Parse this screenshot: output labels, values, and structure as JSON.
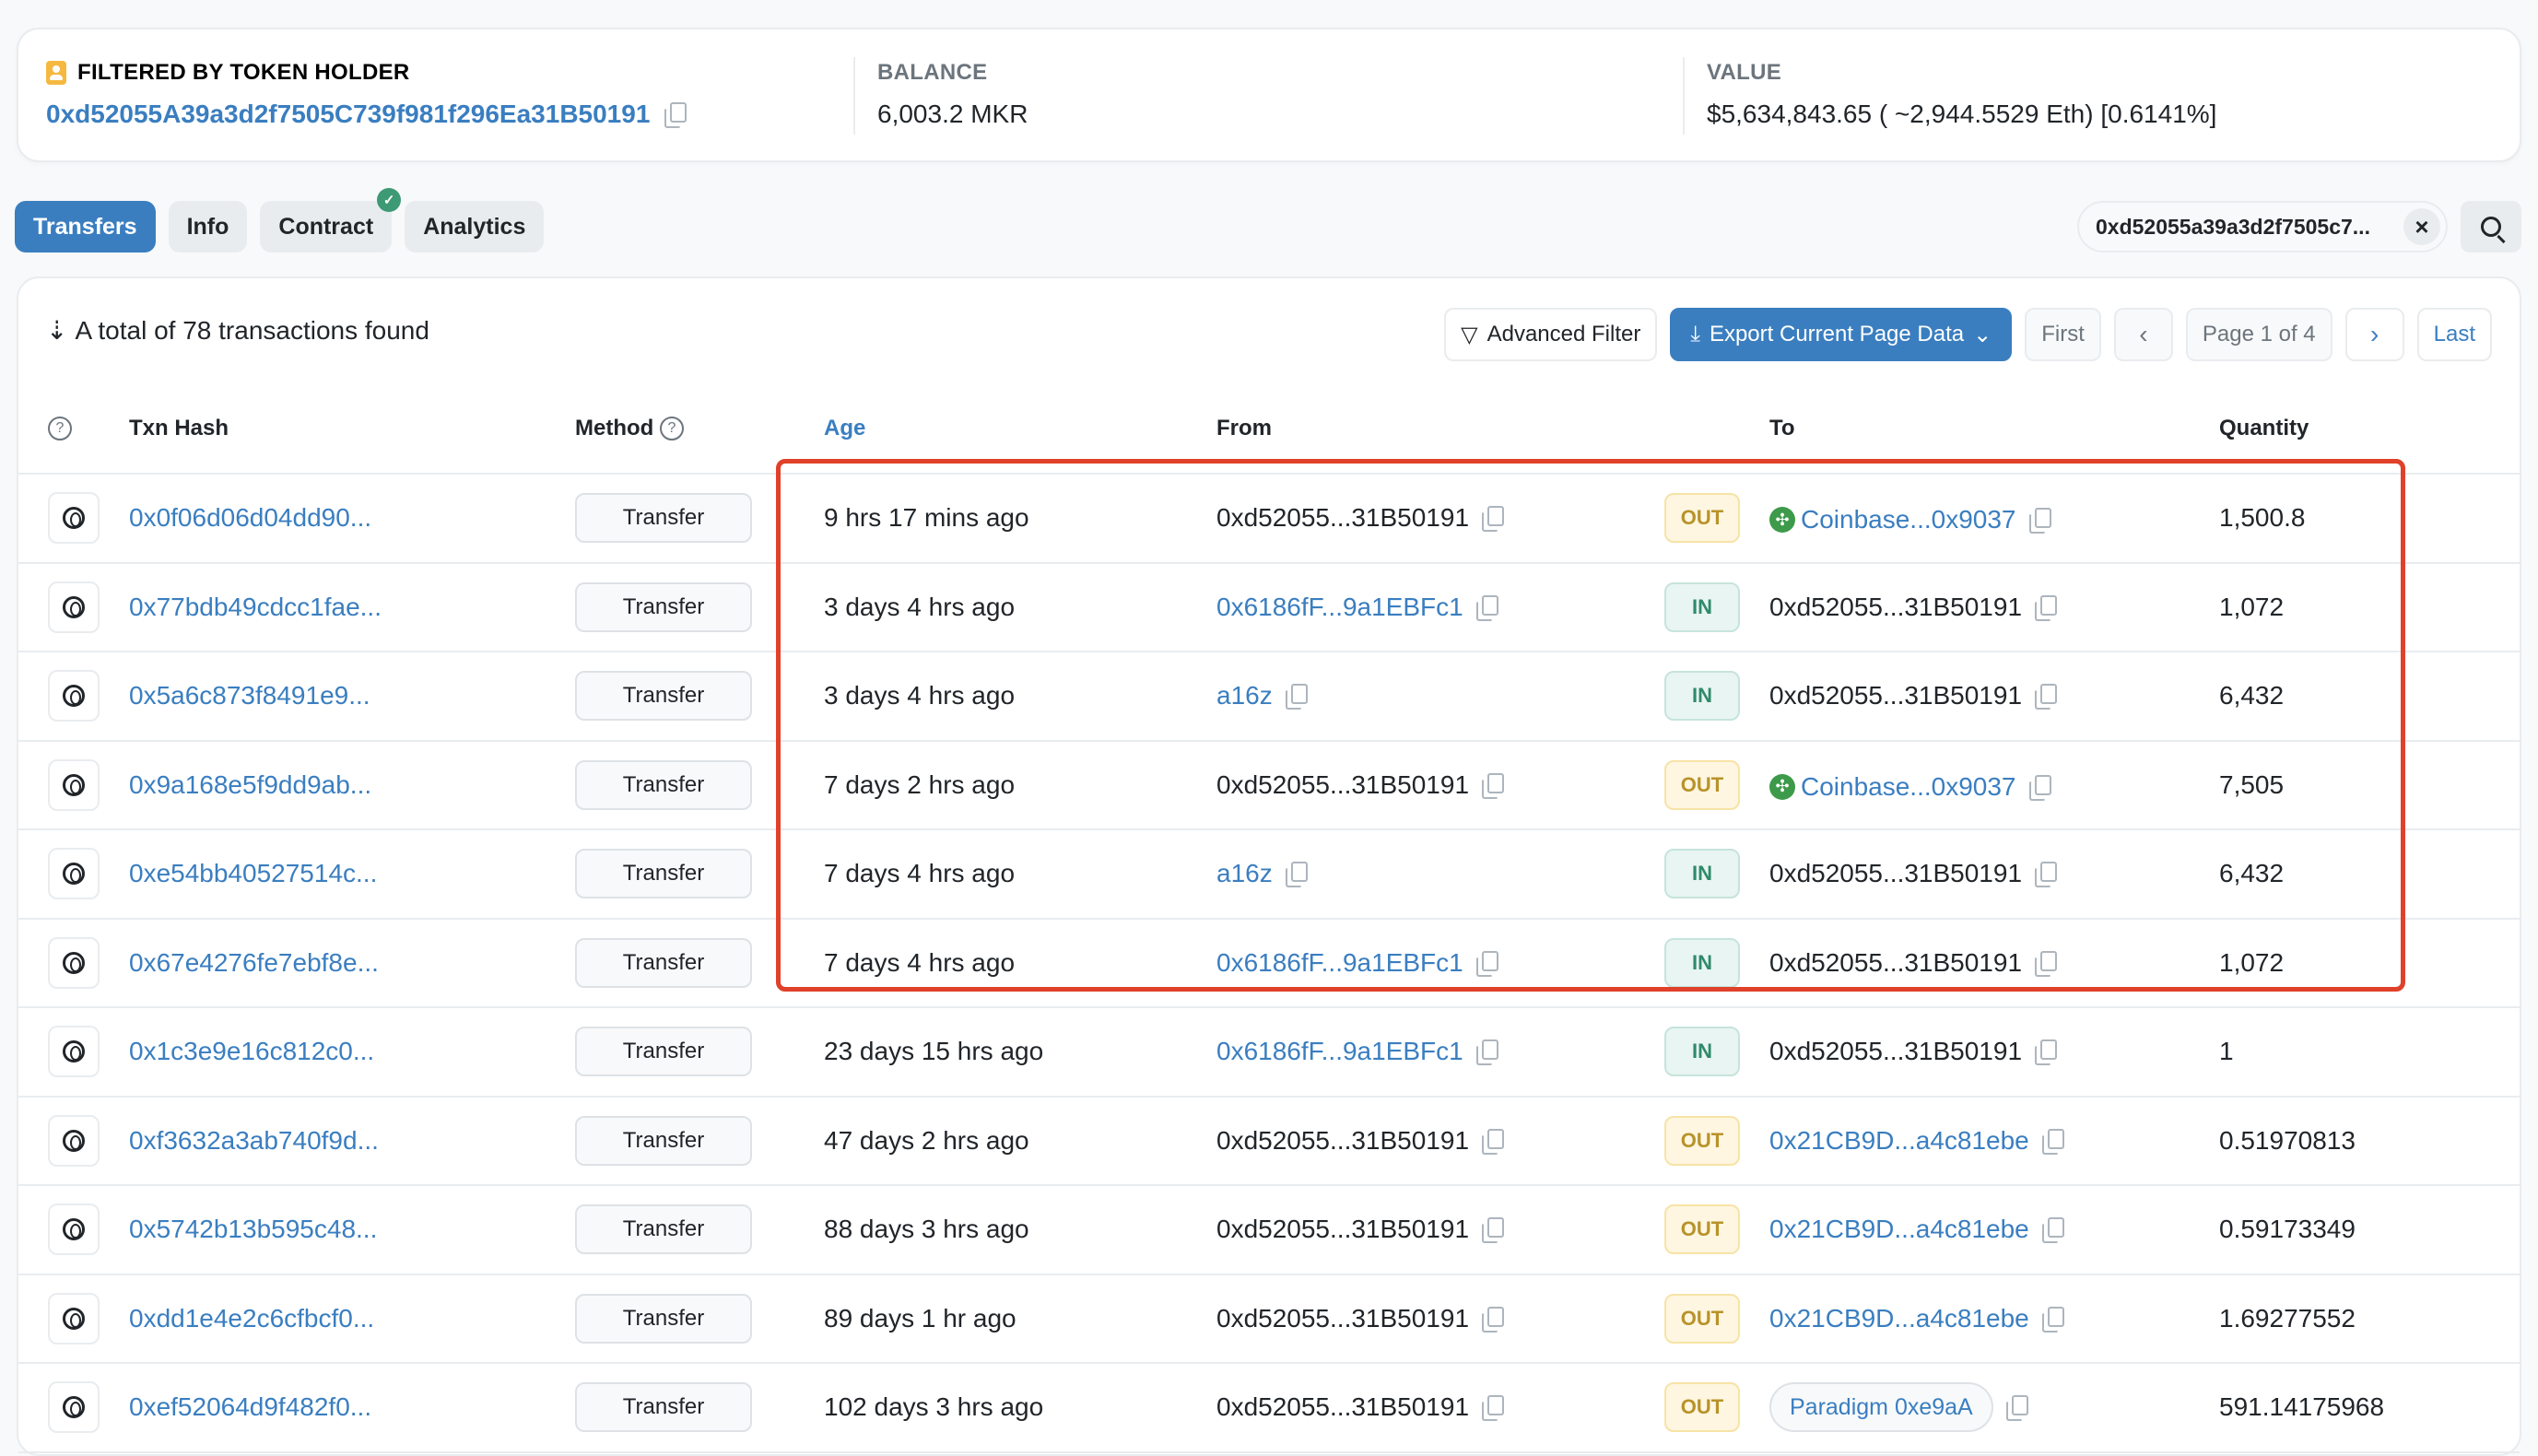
{
  "holder": {
    "label": "FILTERED BY TOKEN HOLDER",
    "address": "0xd52055A39a3d2f7505C739f981f296Ea31B50191"
  },
  "balance": {
    "label": "BALANCE",
    "value": "6,003.2 MKR"
  },
  "value": {
    "label": "VALUE",
    "value": "$5,634,843.65 ( ~2,944.5529 Eth) [0.6141%]"
  },
  "tabs": [
    {
      "label": "Transfers",
      "active": true
    },
    {
      "label": "Info"
    },
    {
      "label": "Contract",
      "verified": true
    },
    {
      "label": "Analytics"
    }
  ],
  "filter_chip": {
    "value": "0xd52055a39a3d2f7505c7...",
    "clear_icon": "close-icon"
  },
  "search_icon": "search-icon",
  "summary": "A total of 78 transactions found",
  "toolbar": {
    "advanced_filter": "Advanced Filter",
    "export": "Export Current Page Data",
    "first": "First",
    "prev": "‹",
    "page": "Page 1 of 4",
    "next": "›",
    "last": "Last"
  },
  "columns": {
    "txn_hash": "Txn Hash",
    "method": "Method",
    "age": "Age",
    "from": "From",
    "to": "To",
    "quantity": "Quantity"
  },
  "rows": [
    {
      "hash": "0x0f06d06d04dd90...",
      "method": "Transfer",
      "age": "9 hrs 17 mins ago",
      "from": "0xd52055...31B50191",
      "from_link": false,
      "dir": "OUT",
      "to": "Coinbase...0x9037",
      "to_type": "coinbase",
      "quantity": "1,500.8"
    },
    {
      "hash": "0x77bdb49cdcc1fae...",
      "method": "Transfer",
      "age": "3 days 4 hrs ago",
      "from": "0x6186fF...9a1EBFc1",
      "from_link": true,
      "dir": "IN",
      "to": "0xd52055...31B50191",
      "to_type": "plain",
      "quantity": "1,072"
    },
    {
      "hash": "0x5a6c873f8491e9...",
      "method": "Transfer",
      "age": "3 days 4 hrs ago",
      "from": "a16z",
      "from_link": true,
      "dir": "IN",
      "to": "0xd52055...31B50191",
      "to_type": "plain",
      "quantity": "6,432"
    },
    {
      "hash": "0x9a168e5f9dd9ab...",
      "method": "Transfer",
      "age": "7 days 2 hrs ago",
      "from": "0xd52055...31B50191",
      "from_link": false,
      "dir": "OUT",
      "to": "Coinbase...0x9037",
      "to_type": "coinbase",
      "quantity": "7,505"
    },
    {
      "hash": "0xe54bb40527514c...",
      "method": "Transfer",
      "age": "7 days 4 hrs ago",
      "from": "a16z",
      "from_link": true,
      "dir": "IN",
      "to": "0xd52055...31B50191",
      "to_type": "plain",
      "quantity": "6,432"
    },
    {
      "hash": "0x67e4276fe7ebf8e...",
      "method": "Transfer",
      "age": "7 days 4 hrs ago",
      "from": "0x6186fF...9a1EBFc1",
      "from_link": true,
      "dir": "IN",
      "to": "0xd52055...31B50191",
      "to_type": "plain",
      "quantity": "1,072"
    },
    {
      "hash": "0x1c3e9e16c812c0...",
      "method": "Transfer",
      "age": "23 days 15 hrs ago",
      "from": "0x6186fF...9a1EBFc1",
      "from_link": true,
      "dir": "IN",
      "to": "0xd52055...31B50191",
      "to_type": "plain",
      "quantity": "1"
    },
    {
      "hash": "0xf3632a3ab740f9d...",
      "method": "Transfer",
      "age": "47 days 2 hrs ago",
      "from": "0xd52055...31B50191",
      "from_link": false,
      "dir": "OUT",
      "to": "0x21CB9D...a4c81ebe",
      "to_type": "link",
      "quantity": "0.51970813"
    },
    {
      "hash": "0x5742b13b595c48...",
      "method": "Transfer",
      "age": "88 days 3 hrs ago",
      "from": "0xd52055...31B50191",
      "from_link": false,
      "dir": "OUT",
      "to": "0x21CB9D...a4c81ebe",
      "to_type": "link",
      "quantity": "0.59173349"
    },
    {
      "hash": "0xdd1e4e2c6cfbcf0...",
      "method": "Transfer",
      "age": "89 days 1 hr ago",
      "from": "0xd52055...31B50191",
      "from_link": false,
      "dir": "OUT",
      "to": "0x21CB9D...a4c81ebe",
      "to_type": "link",
      "quantity": "1.69277552"
    },
    {
      "hash": "0xef52064d9f482f0...",
      "method": "Transfer",
      "age": "102 days 3 hrs ago",
      "from": "0xd52055...31B50191",
      "from_link": false,
      "dir": "OUT",
      "to": "Paradigm 0xe9aA",
      "to_type": "pill",
      "quantity": "591.14175968"
    }
  ],
  "colors": {
    "accent": "#3a7ec0",
    "out_badge": "#b8932a",
    "in_badge": "#2f8a6b",
    "highlight": "#e0412a"
  }
}
